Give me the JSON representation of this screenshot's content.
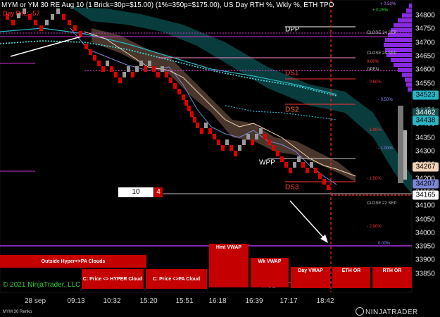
{
  "header": {
    "title": "MYM or YM 30 RE Aug 10 (1 Brick=30p=$15.00) (1%=350p=$175.00), US Day RTH %, Wkly %, ETH TPO",
    "pnl_text": "Day PnL: -57"
  },
  "price_axis": {
    "labels": [
      "34800",
      "34750",
      "34700",
      "34650",
      "34600",
      "34550",
      "34500",
      "34450",
      "34400",
      "34350",
      "34300",
      "34250",
      "34200",
      "34150",
      "34100",
      "34050",
      "34000",
      "33950",
      "33900",
      "33850"
    ],
    "markers": [
      {
        "value": "34523",
        "bg": "#27b6c6",
        "color": "#000000"
      },
      {
        "value": "34462",
        "bg": "#1c4e50",
        "color": "#ffffff"
      },
      {
        "value": "34438",
        "bg": "#27b6c6",
        "color": "#000000"
      },
      {
        "value": "34267",
        "bg": "#f2d3b8",
        "color": "#000000"
      },
      {
        "value": "34207",
        "bg": "#7b86d6",
        "color": "#000000"
      },
      {
        "value": "34165",
        "bg": "#ffffff",
        "color": "#000000"
      }
    ]
  },
  "time_axis": {
    "labels": [
      "28 sep",
      "09:13",
      "10:32",
      "15:20",
      "15:51",
      "16:18",
      "16:39",
      "17:17",
      "18:42"
    ]
  },
  "percent_labels": [
    {
      "text": "+ 0.50%",
      "color": "#c080ff"
    },
    {
      "text": "+ 0.25%",
      "color": "#33dd33"
    },
    {
      "text": "0.00%",
      "color": "#ff3333"
    },
    {
      "text": "- 0.50%",
      "color": "#ff3333"
    },
    {
      "text": "- 0.50%",
      "color": "#9090ff"
    },
    {
      "text": "- 1.00%",
      "color": "#ff3333"
    },
    {
      "text": "- 1.00%",
      "color": "#9090ff"
    },
    {
      "text": "- 1.50%",
      "color": "#ff3333"
    },
    {
      "text": "- 2.00%",
      "color": "#ff3333"
    },
    {
      "text": "0.00%",
      "color": "#9090ff"
    }
  ],
  "levels": {
    "dpp": "DPP",
    "ds1": "DS1",
    "ds2": "DS2",
    "ds3": "DS3",
    "wpp": "WPP",
    "ws1": "WS1"
  },
  "session_tags": {
    "close_24_sep_top": "CLOSE 24 SEP",
    "close_24_sep": "CLOSE 24 SEP",
    "open": "OPEN",
    "close_22_sep": "CLOSE 22 SEP"
  },
  "brick_counter": {
    "count": "10",
    "direction": "4"
  },
  "buttons": {
    "outside_hyper": "Outside Hyper<>PA Clouds",
    "price_hyper": "C: Price <> HYPER Cloud",
    "price_pa": "C: Price <>PA Cloud",
    "hmt_vwap": "Hmt VWAP",
    "wk_vwap": "Wk VWAP",
    "day_vwap": "Day VWAP",
    "eth_or": "ETH OR",
    "rth_or": "RTH OR"
  },
  "copyright": "© 2021 NinjaTrader, LLC",
  "footer": "MYM 30 Renko",
  "logo": "NINJATRADER",
  "colors": {
    "bull_brick": "#9a9a9a",
    "bear_brick": "#dd0000",
    "cloud_teal": "#0e6e70",
    "cloud_peach": "#7a5a4a",
    "magenta": "#cc33cc",
    "dashed_red": "#ff2222",
    "profile_purple": "#8a2be2"
  }
}
